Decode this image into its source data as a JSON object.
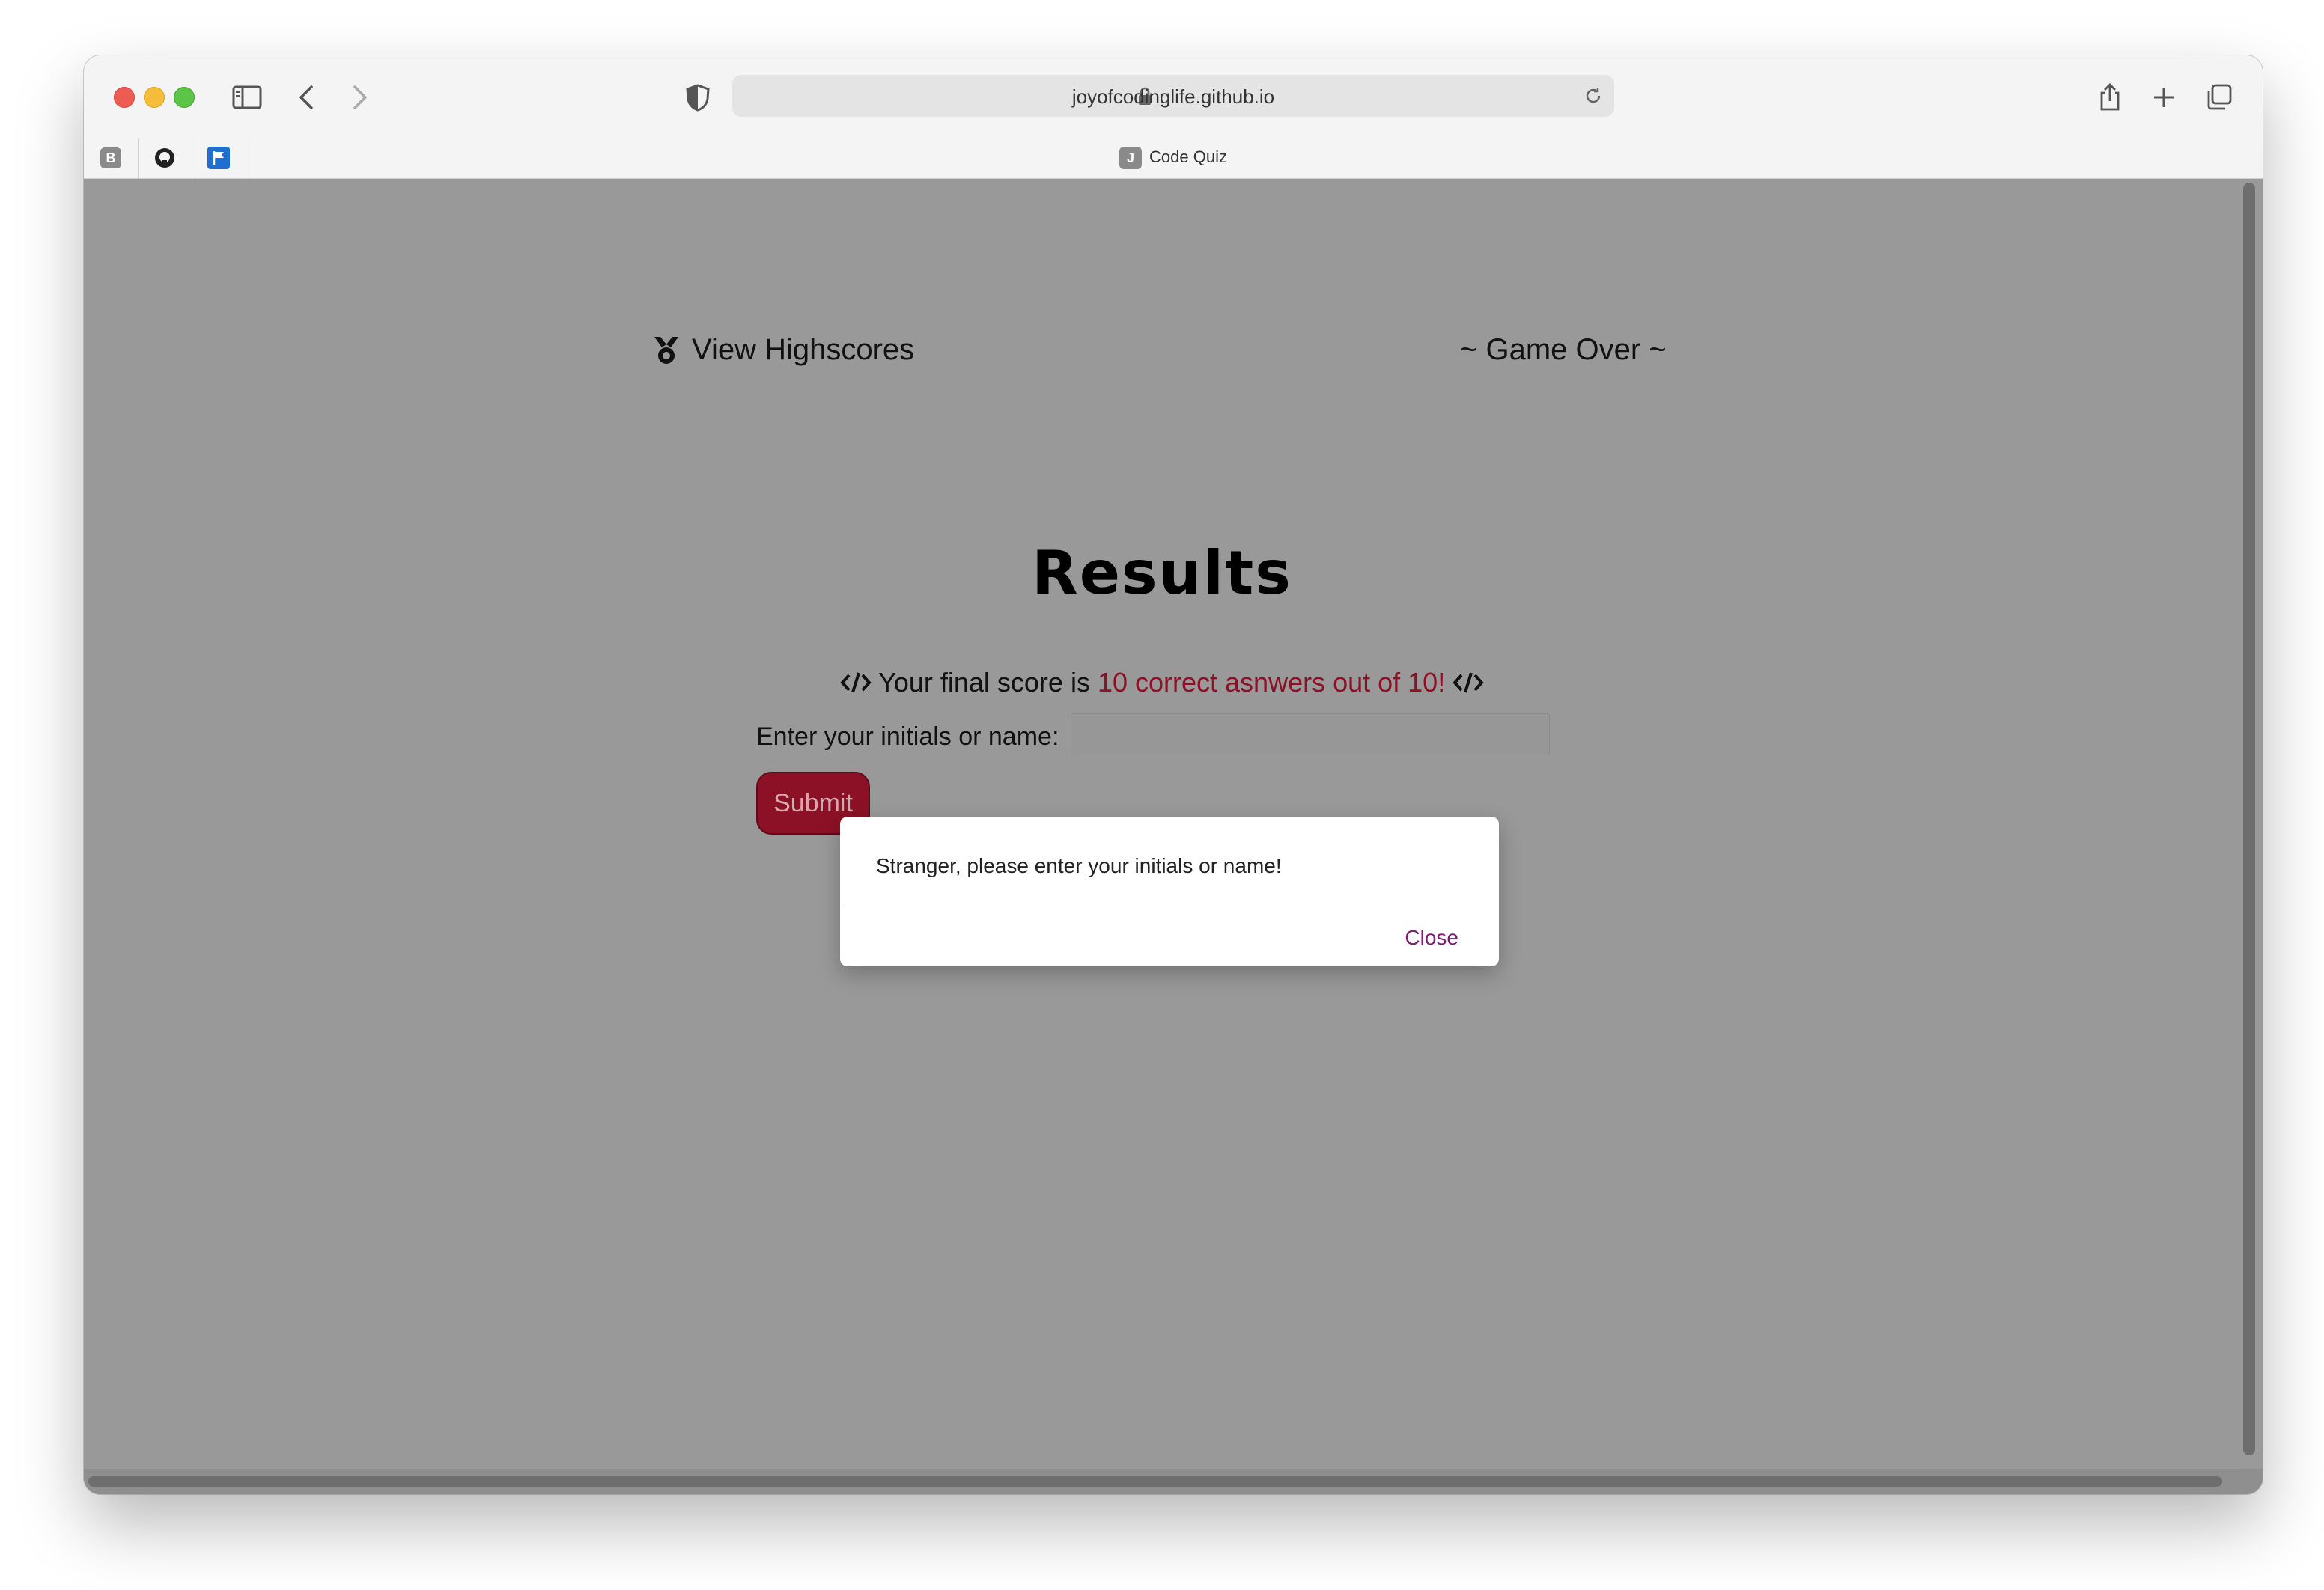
{
  "browser": {
    "url": "joyofcodinglife.github.io",
    "tab_title": "Code Quiz",
    "tab_favicon_letter": "J",
    "favorites": [
      "B",
      "github-icon",
      "flag-icon"
    ]
  },
  "header": {
    "highscores_link": "View Highscores",
    "status": "~ Game Over ~"
  },
  "results": {
    "title": "Results",
    "score_prefix": "Your final score is",
    "score_highlight": "10 correct asnwers out of 10!",
    "initials_label": "Enter your initials or name:",
    "initials_value": "",
    "submit_label": "Submit"
  },
  "dialog": {
    "message": "Stranger, please enter your initials or name!",
    "close_label": "Close"
  },
  "colors": {
    "accent": "#8c1126",
    "page_overlay": "#999999",
    "dialog_link": "#7a1f6e"
  }
}
